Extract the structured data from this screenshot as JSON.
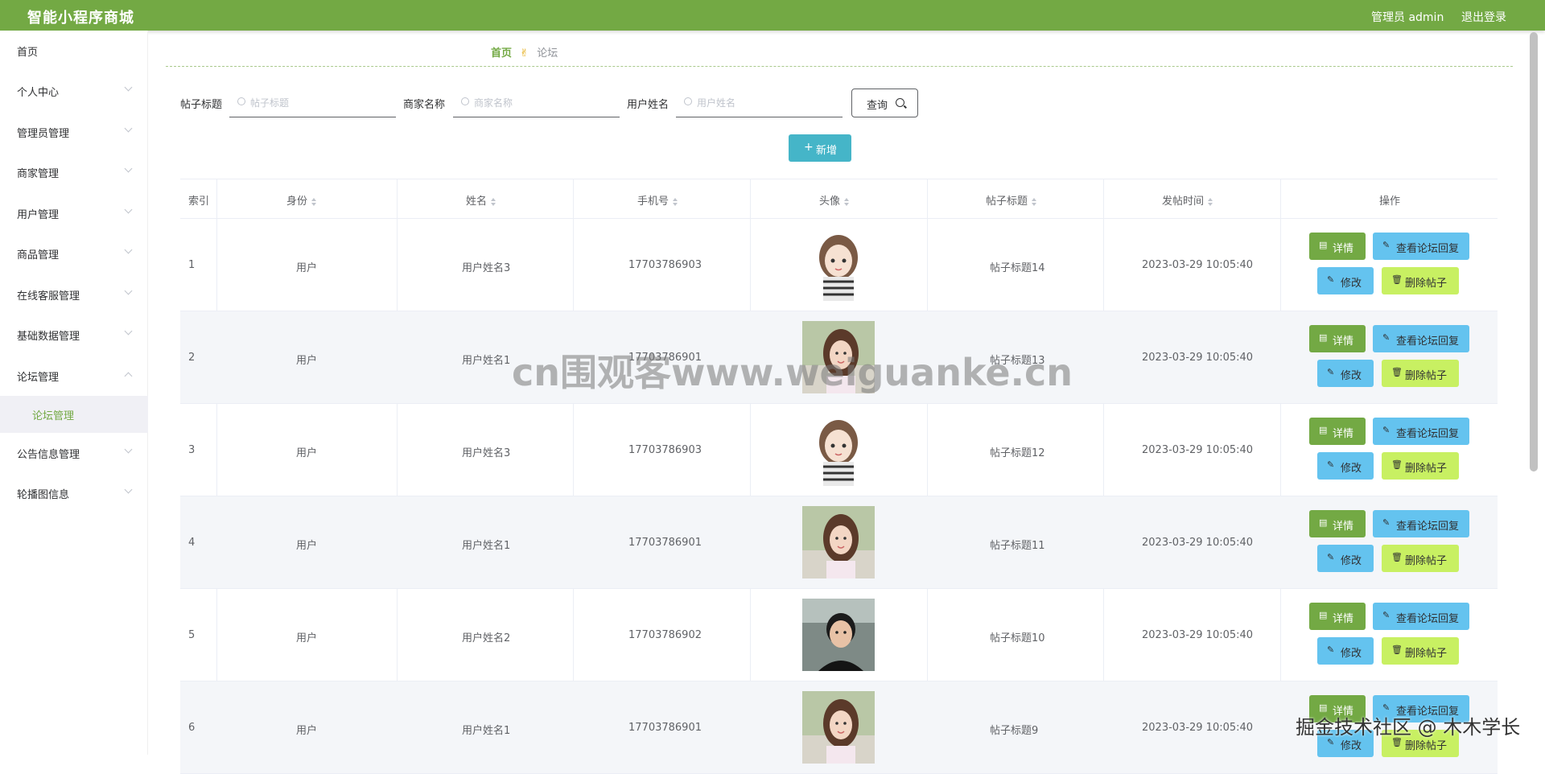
{
  "app": {
    "title": "智能小程序商城",
    "user": "管理员 admin",
    "logout": "退出登录"
  },
  "sidebar": {
    "items": [
      {
        "label": "首页"
      },
      {
        "label": "个人中心"
      },
      {
        "label": "管理员管理"
      },
      {
        "label": "商家管理"
      },
      {
        "label": "用户管理"
      },
      {
        "label": "商品管理"
      },
      {
        "label": "在线客服管理"
      },
      {
        "label": "基础数据管理"
      },
      {
        "label": "论坛管理"
      },
      {
        "label": "公告信息管理"
      },
      {
        "label": "轮播图信息"
      }
    ],
    "sub_active": "论坛管理"
  },
  "breadcrumb": {
    "home": "首页",
    "current": "论坛"
  },
  "search": {
    "title_label": "帖子标题",
    "title_placeholder": "帖子标题",
    "merchant_label": "商家名称",
    "merchant_placeholder": "商家名称",
    "user_label": "用户姓名",
    "user_placeholder": "用户姓名",
    "query_button": "查询",
    "add_button": "新增"
  },
  "table": {
    "columns": [
      "索引",
      "身份",
      "姓名",
      "手机号",
      "头像",
      "帖子标题",
      "发帖时间",
      "操作"
    ],
    "rows": [
      {
        "index": "1",
        "identity": "用户",
        "name": "用户姓名3",
        "phone": "17703786903",
        "avatar": "girl-cartoon",
        "title": "帖子标题14",
        "time": "2023-03-29 10:05:40"
      },
      {
        "index": "2",
        "identity": "用户",
        "name": "用户姓名1",
        "phone": "17703786901",
        "avatar": "girl-photo",
        "title": "帖子标题13",
        "time": "2023-03-29 10:05:40"
      },
      {
        "index": "3",
        "identity": "用户",
        "name": "用户姓名3",
        "phone": "17703786903",
        "avatar": "girl-cartoon",
        "title": "帖子标题12",
        "time": "2023-03-29 10:05:40"
      },
      {
        "index": "4",
        "identity": "用户",
        "name": "用户姓名1",
        "phone": "17703786901",
        "avatar": "girl-photo",
        "title": "帖子标题11",
        "time": "2023-03-29 10:05:40"
      },
      {
        "index": "5",
        "identity": "用户",
        "name": "用户姓名2",
        "phone": "17703786902",
        "avatar": "man-photo",
        "title": "帖子标题10",
        "time": "2023-03-29 10:05:40"
      },
      {
        "index": "6",
        "identity": "用户",
        "name": "用户姓名1",
        "phone": "17703786901",
        "avatar": "girl-photo",
        "title": "帖子标题9",
        "time": "2023-03-29 10:05:40"
      }
    ],
    "actions": {
      "detail": "详情",
      "reply": "查看论坛回复",
      "edit": "修改",
      "delete": "删除帖子"
    }
  },
  "watermark": "cn围观客www.weiguanke.cn",
  "corner_watermark": "掘金技术社区 @ 木木学长",
  "colors": {
    "primary": "#73a944",
    "add": "#45b5c8",
    "info": "#64c3ef",
    "warning": "#c8f062"
  }
}
